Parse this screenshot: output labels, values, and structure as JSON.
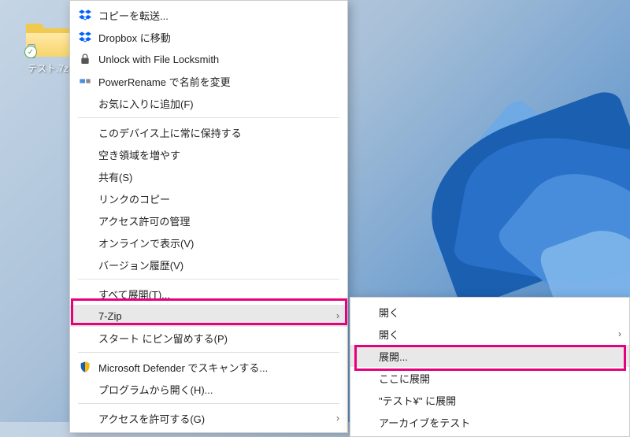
{
  "desktop": {
    "file_label": "テスト.7z"
  },
  "main_menu": {
    "groups": [
      [
        {
          "icon": "dropbox",
          "label": "コピーを転送...",
          "arrow": false
        },
        {
          "icon": "dropbox",
          "label": "Dropbox に移動",
          "arrow": false
        },
        {
          "icon": "lock",
          "label": "Unlock with File Locksmith",
          "arrow": false
        },
        {
          "icon": "rename",
          "label": "PowerRename で名前を変更",
          "arrow": false
        },
        {
          "icon": "",
          "label": "お気に入りに追加(F)",
          "arrow": false
        }
      ],
      [
        {
          "icon": "",
          "label": "このデバイス上に常に保持する",
          "arrow": false
        },
        {
          "icon": "",
          "label": "空き領域を増やす",
          "arrow": false
        },
        {
          "icon": "",
          "label": "共有(S)",
          "arrow": false
        },
        {
          "icon": "",
          "label": "リンクのコピー",
          "arrow": false
        },
        {
          "icon": "",
          "label": "アクセス許可の管理",
          "arrow": false
        },
        {
          "icon": "",
          "label": "オンラインで表示(V)",
          "arrow": false
        },
        {
          "icon": "",
          "label": "バージョン履歴(V)",
          "arrow": false
        }
      ],
      [
        {
          "icon": "",
          "label": "すべて展開(T)...",
          "arrow": false
        },
        {
          "icon": "",
          "label": "7-Zip",
          "arrow": true,
          "highlight": true
        },
        {
          "icon": "",
          "label": "スタート にピン留めする(P)",
          "arrow": false
        }
      ],
      [
        {
          "icon": "shield",
          "label": "Microsoft Defender でスキャンする...",
          "arrow": false
        },
        {
          "icon": "",
          "label": "プログラムから開く(H)...",
          "arrow": false
        }
      ],
      [
        {
          "icon": "",
          "label": "アクセスを許可する(G)",
          "arrow": true
        }
      ]
    ]
  },
  "sub_menu": {
    "items": [
      {
        "label": "開く",
        "arrow": false
      },
      {
        "label": "開く",
        "arrow": true
      },
      {
        "label": "展開...",
        "arrow": false,
        "highlight": true
      },
      {
        "label": "ここに展開",
        "arrow": false
      },
      {
        "label": "\"テスト¥\" に展開",
        "arrow": false
      },
      {
        "label": "アーカイブをテスト",
        "arrow": false
      }
    ]
  }
}
